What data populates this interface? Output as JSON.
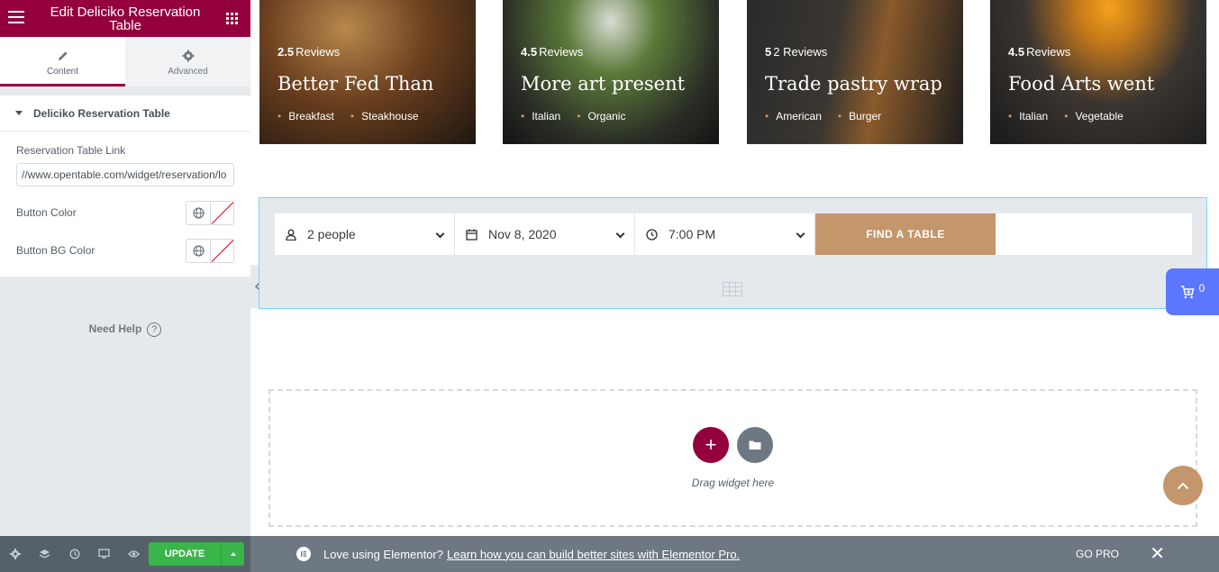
{
  "panel": {
    "title": "Edit Deliciko Reservation Table",
    "tabs": [
      {
        "label": "Content"
      },
      {
        "label": "Advanced"
      }
    ],
    "section_title": "Deliciko Reservation Table",
    "link_label": "Reservation Table Link",
    "link_value": "//www.opentable.com/widget/reservation/lo",
    "button_color_label": "Button Color",
    "button_bg_color_label": "Button BG Color",
    "need_help": "Need Help",
    "help_glyph": "?"
  },
  "footer": {
    "update_label": "UPDATE"
  },
  "promo": {
    "message": "Love using Elementor?",
    "link": "Learn how you can build better sites with Elementor Pro.",
    "go_pro": "GO PRO",
    "close_glyph": "✕"
  },
  "cards": [
    {
      "rating": "2.5",
      "reviews": "Reviews",
      "name": "Better Fed Than",
      "tags": [
        "Breakfast",
        "Steakhouse"
      ]
    },
    {
      "rating": "4.5",
      "reviews": "Reviews",
      "name": "More art present",
      "tags": [
        "Italian",
        "Organic"
      ]
    },
    {
      "rating": "5",
      "reviews": "2 Reviews",
      "name": "Trade pastry wrap",
      "tags": [
        "American",
        "Burger"
      ]
    },
    {
      "rating": "4.5",
      "reviews": "Reviews",
      "name": "Food Arts went",
      "tags": [
        "Italian",
        "Vegetable"
      ]
    }
  ],
  "reservation": {
    "people": "2 people",
    "date": "Nov 8, 2020",
    "time": "7:00 PM",
    "find_label": "FIND A TABLE"
  },
  "cart": {
    "count": "0"
  },
  "drop_zone": {
    "label": "Drag widget here",
    "add_glyph": "+"
  },
  "colors": {
    "brand": "#93003c",
    "accent": "#c4966c",
    "update_green": "#39b54a",
    "cart_blue": "#5b76ff"
  },
  "icons": [
    "menu-icon",
    "apps-grid-icon",
    "pencil-icon",
    "gear-icon",
    "globe-icon",
    "help-icon",
    "settings-icon",
    "layers-icon",
    "history-icon",
    "responsive-icon",
    "eye-icon",
    "user-icon",
    "calendar-icon",
    "clock-icon",
    "table-icon",
    "cart-icon",
    "plus-icon",
    "folder-icon",
    "chevron-up-icon",
    "elementor-logo-icon",
    "close-icon"
  ]
}
